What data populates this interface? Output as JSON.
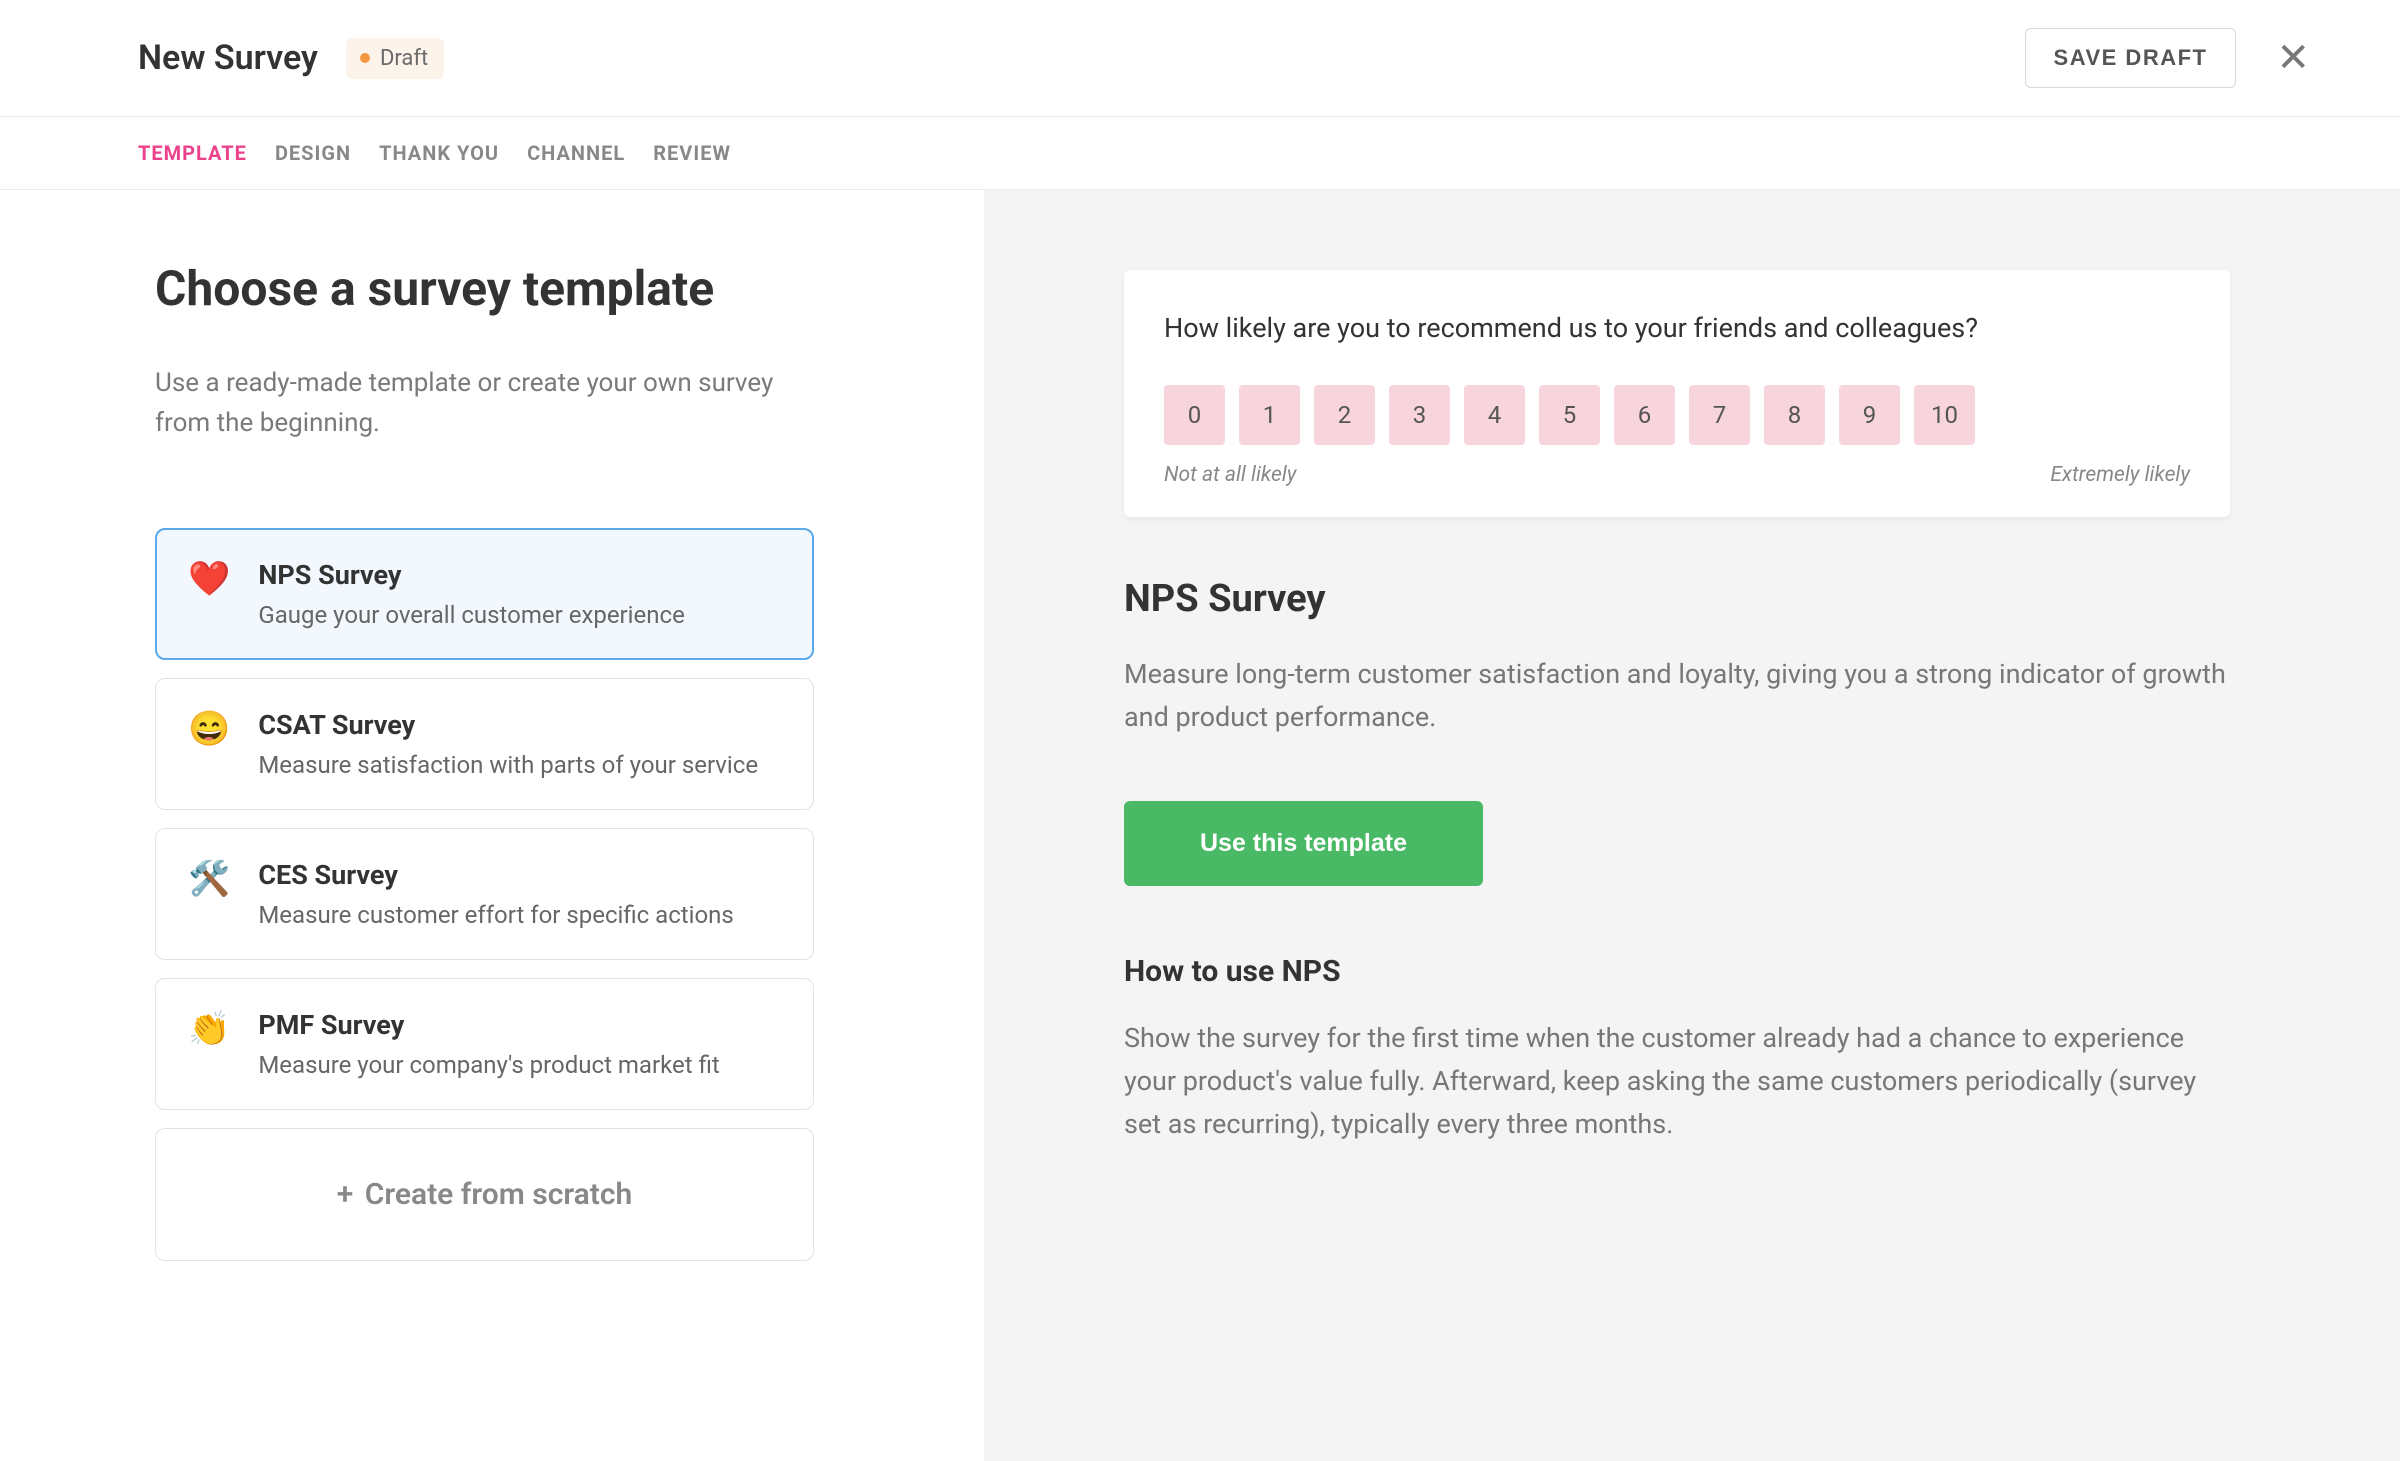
{
  "header": {
    "title": "New Survey",
    "status_label": "Draft",
    "save_draft_label": "SAVE DRAFT"
  },
  "tabs": [
    "TEMPLATE",
    "DESIGN",
    "THANK YOU",
    "CHANNEL",
    "REVIEW"
  ],
  "left": {
    "heading": "Choose a survey template",
    "sub": "Use a ready-made template or create your own survey from the beginning.",
    "cards": [
      {
        "icon": "❤️",
        "title": "NPS Survey",
        "desc": "Gauge your overall customer experience"
      },
      {
        "icon": "😄",
        "title": "CSAT Survey",
        "desc": "Measure satisfaction with parts of your service"
      },
      {
        "icon": "🛠️",
        "title": "CES Survey",
        "desc": "Measure customer effort for specific actions"
      },
      {
        "icon": "👏",
        "title": "PMF Survey",
        "desc": "Measure your company's product market fit"
      }
    ],
    "scratch_label": "Create from scratch"
  },
  "preview": {
    "question": "How likely are you to recommend us to your friends and colleagues?",
    "scores": [
      "0",
      "1",
      "2",
      "3",
      "4",
      "5",
      "6",
      "7",
      "8",
      "9",
      "10"
    ],
    "low_label": "Not at all likely",
    "high_label": "Extremely likely"
  },
  "detail": {
    "title": "NPS Survey",
    "desc": "Measure long-term customer satisfaction and loyalty, giving you a strong indicator of growth and product performance.",
    "cta": "Use this template",
    "howto_title": "How to use NPS",
    "howto_body": "Show the survey for the first time when the customer already had a chance to experience your product's value fully. Afterward, keep asking the same customers periodically (survey set as recurring), typically every three months."
  }
}
